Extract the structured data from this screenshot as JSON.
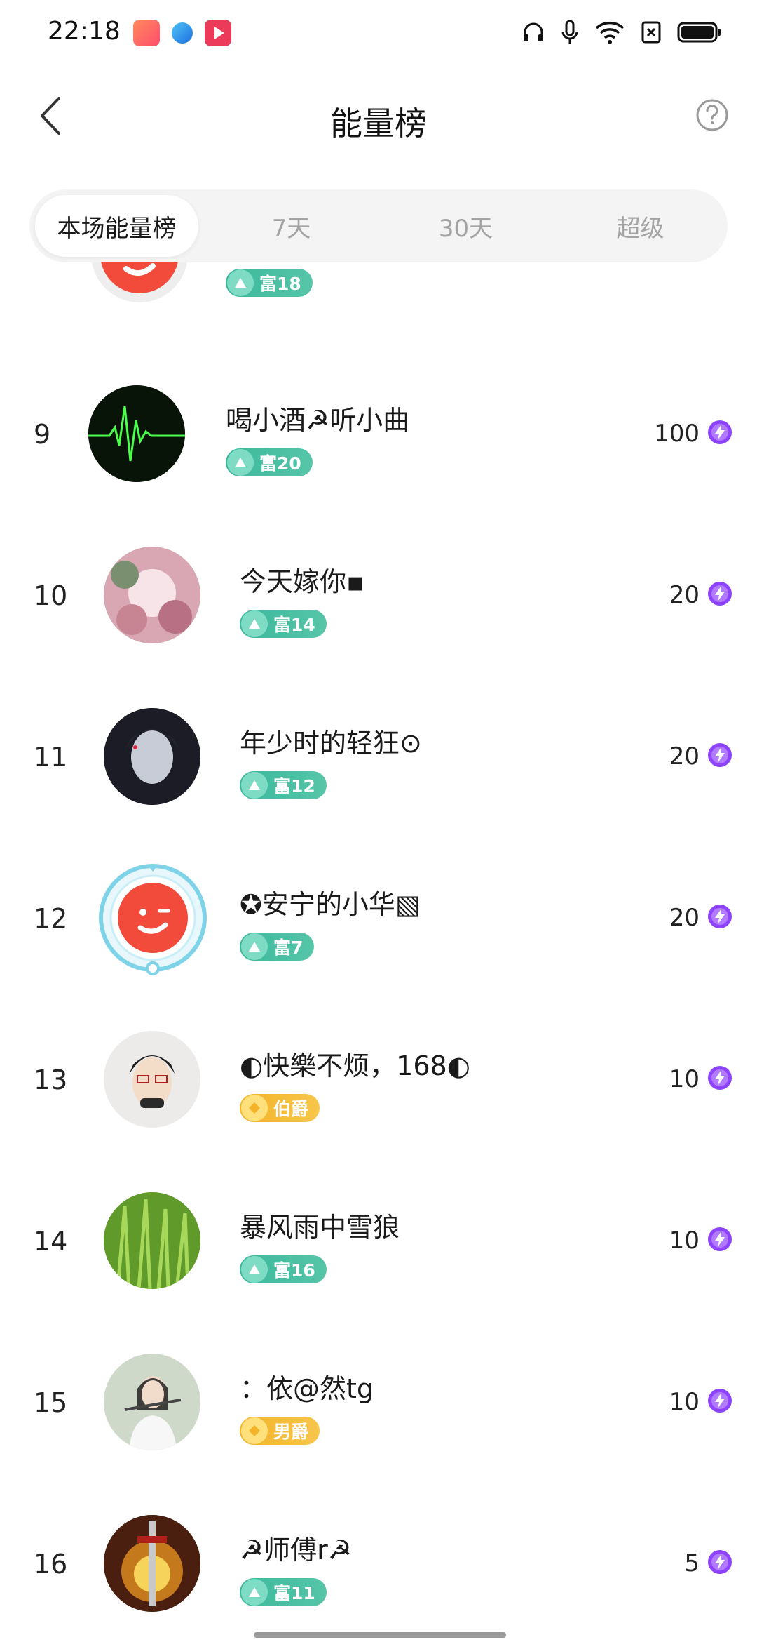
{
  "status_bar": {
    "time": "22:18"
  },
  "header": {
    "title": "能量榜"
  },
  "tabs": [
    {
      "label": "本场能量榜",
      "active": true
    },
    {
      "label": "7天",
      "active": false
    },
    {
      "label": "30天",
      "active": false
    },
    {
      "label": "超级",
      "active": false
    }
  ],
  "partial_row": {
    "badge": "富18"
  },
  "rows": [
    {
      "rank": "9",
      "name": "喝小酒☭听小曲",
      "badge": "富20",
      "badge_type": "rich",
      "score": "100"
    },
    {
      "rank": "10",
      "name": "今天嫁你▪",
      "badge": "富14",
      "badge_type": "rich",
      "score": "20"
    },
    {
      "rank": "11",
      "name": "年少时的轻狂⊙",
      "badge": "富12",
      "badge_type": "rich",
      "score": "20"
    },
    {
      "rank": "12",
      "name": "✪安宁的小华▧",
      "badge": "富7",
      "badge_type": "rich",
      "score": "20"
    },
    {
      "rank": "13",
      "name": "◐快樂不烦，168◐",
      "badge": "伯爵",
      "badge_type": "gold",
      "score": "10"
    },
    {
      "rank": "14",
      "name": "暴风雨中雪狼",
      "badge": "富16",
      "badge_type": "rich",
      "score": "10"
    },
    {
      "rank": "15",
      "name": "：依@然tg",
      "badge": "男爵",
      "badge_type": "gold",
      "score": "10"
    },
    {
      "rank": "16",
      "name": "☭师傅r☭",
      "badge": "富11",
      "badge_type": "rich",
      "score": "5"
    }
  ],
  "colors": {
    "accent_rich": "#3bb89c",
    "accent_gold": "#f3b32a",
    "energy": "#8e44ff"
  }
}
